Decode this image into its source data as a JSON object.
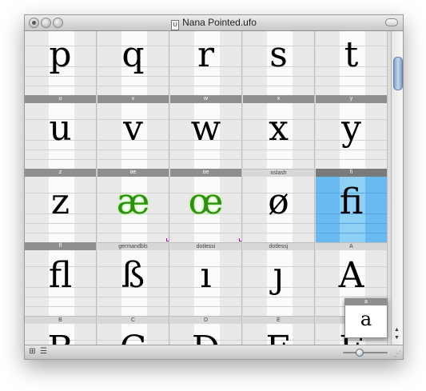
{
  "window": {
    "title": "Nana Pointed.ufo"
  },
  "cells": [
    {
      "name": "p",
      "char": "p"
    },
    {
      "name": "q",
      "char": "q"
    },
    {
      "name": "r",
      "char": "r"
    },
    {
      "name": "s",
      "char": "s"
    },
    {
      "name": "t",
      "char": "t"
    },
    {
      "name": "u",
      "char": "u"
    },
    {
      "name": "v",
      "char": "v"
    },
    {
      "name": "w",
      "char": "w"
    },
    {
      "name": "x",
      "char": "x"
    },
    {
      "name": "y",
      "char": "y"
    },
    {
      "name": "z",
      "char": "z"
    },
    {
      "name": "ae",
      "char": "æ"
    },
    {
      "name": "oe",
      "char": "œ"
    },
    {
      "name": "oslash",
      "char": "ø"
    },
    {
      "name": "fi",
      "char": "fi"
    },
    {
      "name": "fl",
      "char": "fl"
    },
    {
      "name": "germandbls",
      "char": "ß"
    },
    {
      "name": "dotlessi",
      "char": "ı"
    },
    {
      "name": "dotlessj",
      "char": "ȷ"
    },
    {
      "name": "A",
      "char": "A"
    },
    {
      "name": "B",
      "char": "B"
    },
    {
      "name": "C",
      "char": "C"
    },
    {
      "name": "D",
      "char": "D"
    },
    {
      "name": "E",
      "char": "E"
    },
    {
      "name": "F",
      "char": "F"
    }
  ],
  "selected_glyph": "fi",
  "marked_glyphs": [
    "ae",
    "oe"
  ],
  "preview": {
    "label": "a",
    "char": "a"
  },
  "colors": {
    "selection": "#68baf0",
    "mark": "#2c8f10"
  },
  "icons": {
    "grid_view": "grid-icon",
    "list_view": "list-icon"
  }
}
